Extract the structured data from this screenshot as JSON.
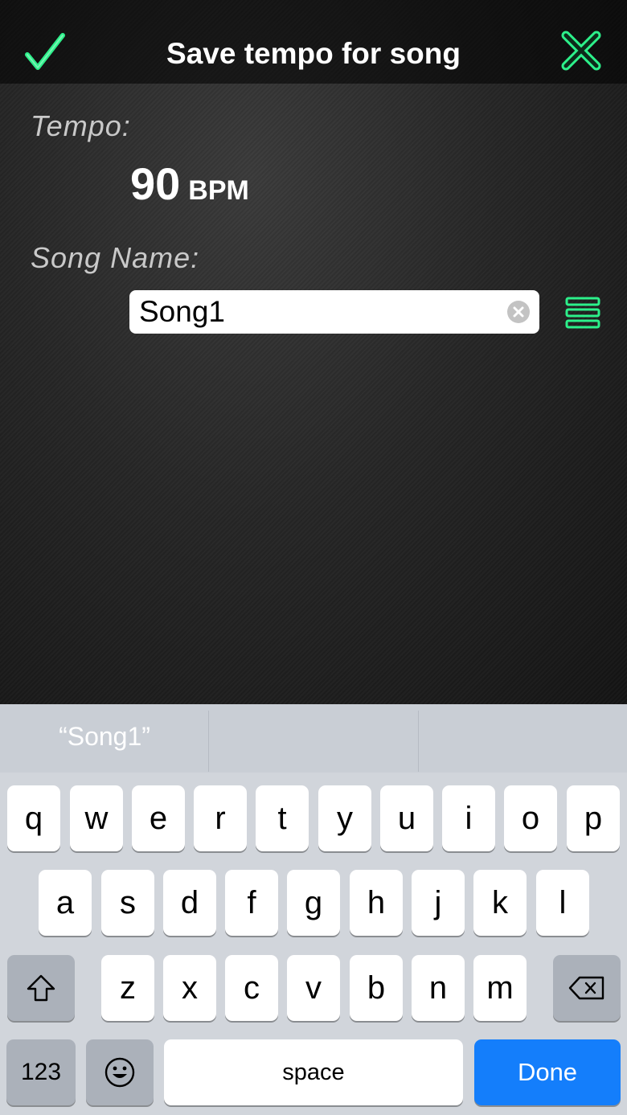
{
  "header": {
    "title": "Save tempo for song",
    "confirm_icon": "check-icon",
    "close_icon": "close-icon"
  },
  "tempo": {
    "label": "Tempo:",
    "value": "90",
    "unit": "BPM"
  },
  "song": {
    "label": "Song Name:",
    "value": "Song1",
    "clear_icon": "clear-icon",
    "list_icon": "list-icon"
  },
  "colors": {
    "accent": "#2cf08a",
    "done_key": "#147efb"
  },
  "keyboard": {
    "suggestions": [
      "“Song1”",
      "",
      ""
    ],
    "row1": [
      "q",
      "w",
      "e",
      "r",
      "t",
      "y",
      "u",
      "i",
      "o",
      "p"
    ],
    "row2": [
      "a",
      "s",
      "d",
      "f",
      "g",
      "h",
      "j",
      "k",
      "l"
    ],
    "row3": [
      "z",
      "x",
      "c",
      "v",
      "b",
      "n",
      "m"
    ],
    "numbers_label": "123",
    "space_label": "space",
    "done_label": "Done"
  }
}
